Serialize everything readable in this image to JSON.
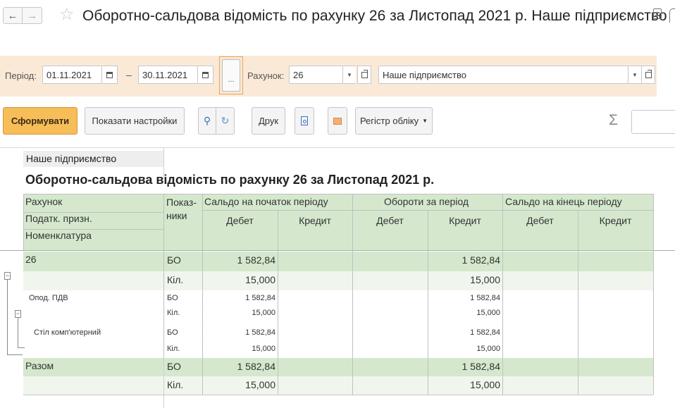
{
  "window": {
    "title": "Оборотно-сальдова відомість по рахунку 26 за Листопад 2021 р. Наше підприємство"
  },
  "params": {
    "period_label": "Період:",
    "date_from": "01.11.2021",
    "date_to": "30.11.2021",
    "dash": "–",
    "dots_label": "...",
    "account_label": "Рахунок:",
    "account_value": "26",
    "org_value": "Наше підприємство"
  },
  "toolbar": {
    "generate_label": "Сформувати",
    "show_settings_label": "Показати настройки",
    "print_label": "Друк",
    "register_label": "Регістр обліку",
    "sigma": "Σ"
  },
  "report": {
    "org_name": "Наше підприємство",
    "title": "Оборотно-сальдова відомість по рахунку 26 за Листопад 2021 р.",
    "headers": {
      "row_labels": [
        "Рахунок",
        "Податк. призн.",
        "Номенклатура"
      ],
      "indicators": "Показ-\nники",
      "groups": [
        "Сальдо на початок періоду",
        "Обороти за період",
        "Сальдо на кінець періоду"
      ],
      "debit": "Дебет",
      "credit": "Кредит"
    },
    "rows": [
      {
        "name": "26",
        "ind": "БО",
        "open_debit": "1 582,84",
        "open_credit": "",
        "turn_debit": "",
        "turn_credit": "1 582,84",
        "close_debit": "",
        "close_credit": ""
      },
      {
        "name": "",
        "ind": "Кіл.",
        "open_debit": "15,000",
        "open_credit": "",
        "turn_debit": "",
        "turn_credit": "15,000",
        "close_debit": "",
        "close_credit": ""
      },
      {
        "name": "Опод. ПДВ",
        "ind": "БО",
        "open_debit": "1 582,84",
        "open_credit": "",
        "turn_debit": "",
        "turn_credit": "1 582,84",
        "close_debit": "",
        "close_credit": ""
      },
      {
        "name": "",
        "ind": "Кіл.",
        "open_debit": "15,000",
        "open_credit": "",
        "turn_debit": "",
        "turn_credit": "15,000",
        "close_debit": "",
        "close_credit": ""
      },
      {
        "name": "Стіл комп'ютерний",
        "ind": "БО",
        "open_debit": "1 582,84",
        "open_credit": "",
        "turn_debit": "",
        "turn_credit": "1 582,84",
        "close_debit": "",
        "close_credit": ""
      },
      {
        "name": "",
        "ind": "Кіл.",
        "open_debit": "15,000",
        "open_credit": "",
        "turn_debit": "",
        "turn_credit": "15,000",
        "close_debit": "",
        "close_credit": ""
      },
      {
        "name": "Разом",
        "ind": "БО",
        "open_debit": "1 582,84",
        "open_credit": "",
        "turn_debit": "",
        "turn_credit": "1 582,84",
        "close_debit": "",
        "close_credit": ""
      },
      {
        "name": "",
        "ind": "Кіл.",
        "open_debit": "15,000",
        "open_credit": "",
        "turn_debit": "",
        "turn_credit": "15,000",
        "close_debit": "",
        "close_credit": ""
      }
    ]
  },
  "icons": {
    "back": "arrow-left-icon",
    "forward": "arrow-right-icon",
    "favorite": "star-icon",
    "calendar": "calendar-icon",
    "dropdown": "chevron-down-icon",
    "open": "open-form-icon",
    "find": "search-icon",
    "find_next": "search-next-icon",
    "preview": "print-preview-icon",
    "email": "mail-icon",
    "more": "more-menu-icon"
  },
  "colors": {
    "param_panel_bg": "#fbe9d7",
    "primary_button": "#f6bd59",
    "header_green": "#d5e8cd",
    "row_light_green": "#f0f6ed"
  }
}
